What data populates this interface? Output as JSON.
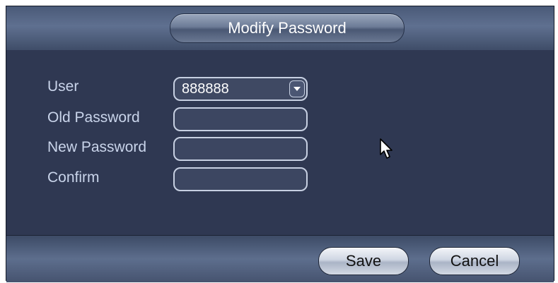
{
  "dialog": {
    "title": "Modify Password"
  },
  "form": {
    "user_label": "User",
    "user_value": "888888",
    "old_password_label": "Old Password",
    "new_password_label": "New Password",
    "confirm_label": "Confirm"
  },
  "buttons": {
    "save": "Save",
    "cancel": "Cancel"
  },
  "icons": {
    "dropdown": "chevron-down-icon",
    "cursor": "mouse-pointer-icon"
  },
  "colors": {
    "panel": "#2f3852",
    "label": "#c9d4ea",
    "field_border": "#c7d0e2"
  }
}
